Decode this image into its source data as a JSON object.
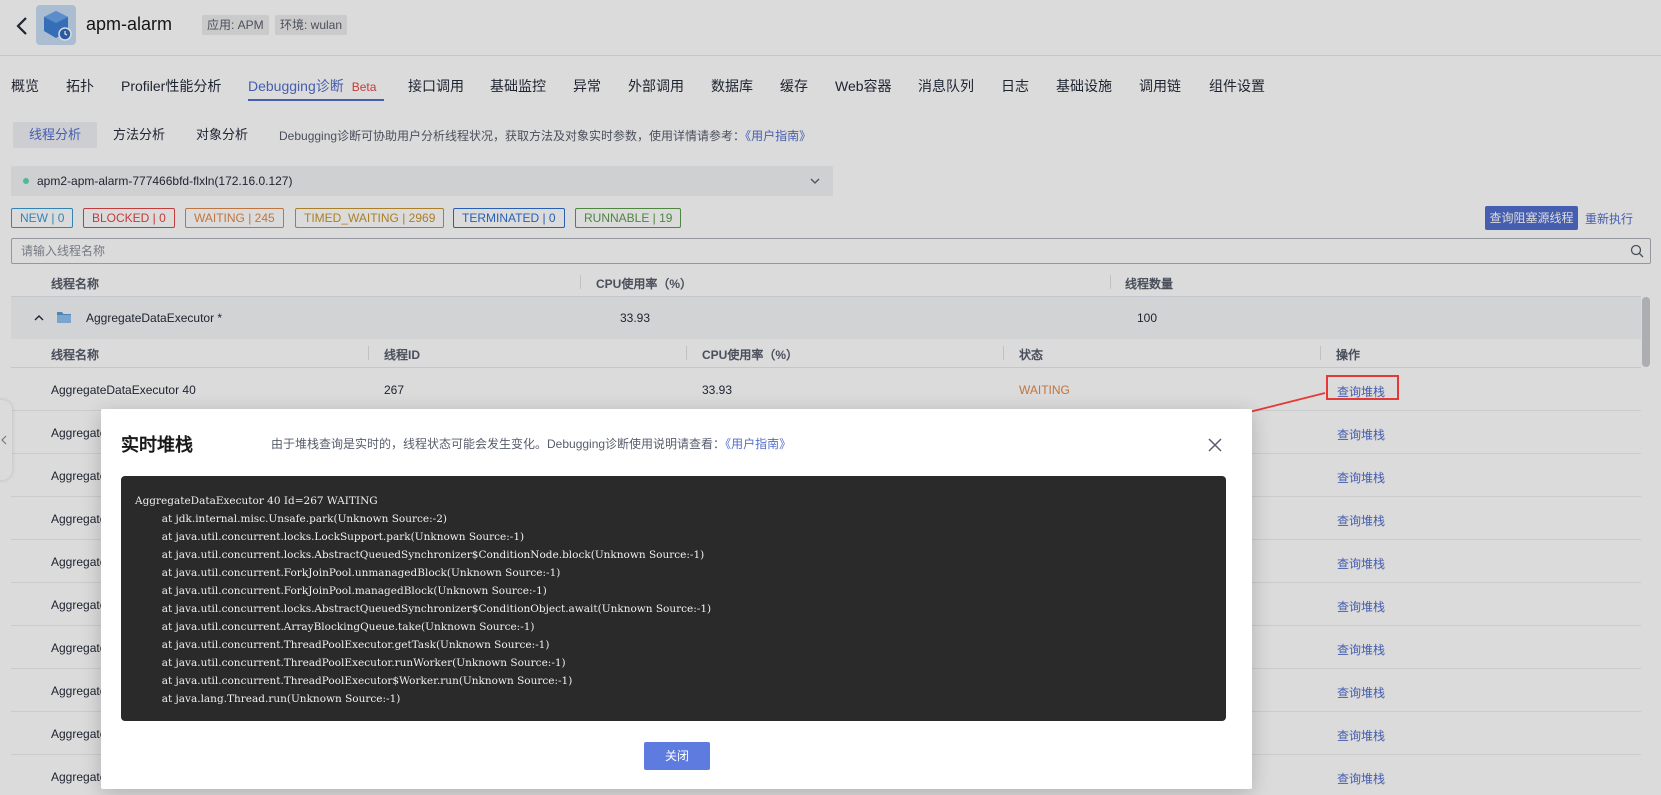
{
  "header": {
    "app_name": "apm-alarm",
    "app_tag": "应用: APM",
    "env_tag": "环境: wulan"
  },
  "nav": {
    "items": [
      "概览",
      "拓扑",
      "Profiler性能分析",
      "Debugging诊断",
      "接口调用",
      "基础监控",
      "异常",
      "外部调用",
      "数据库",
      "缓存",
      "Web容器",
      "消息队列",
      "日志",
      "基础设施",
      "调用链",
      "组件设置"
    ],
    "beta": "Beta"
  },
  "subtabs": {
    "thread": "线程分析",
    "method": "方法分析",
    "object": "对象分析",
    "hint": "Debugging诊断可协助用户分析线程状况，获取方法及对象实时参数，使用详情请参考：",
    "guide": "《用户指南》"
  },
  "instance": {
    "value": "apm2-apm-alarm-777466bfd-flxln(172.16.0.127)"
  },
  "badges": [
    {
      "label": "NEW | 0",
      "color": "#3a9bd4"
    },
    {
      "label": "BLOCKED | 0",
      "color": "#e54545"
    },
    {
      "label": "WAITING | 245",
      "color": "#e0894a"
    },
    {
      "label": "TIMED_WAITING | 2969",
      "color": "#c7942e"
    },
    {
      "label": "TERMINATED | 0",
      "color": "#2f6fd4"
    },
    {
      "label": "RUNNABLE | 19",
      "color": "#5c9b4a"
    }
  ],
  "actions": {
    "query_blocked": "查询阻塞源线程",
    "rerun": "重新执行"
  },
  "search": {
    "placeholder": "请输入线程名称"
  },
  "table": {
    "group_headers": [
      "线程名称",
      "CPU使用率（%）",
      "线程数量"
    ],
    "group": {
      "name": "AggregateDataExecutor *",
      "cpu": "33.93",
      "count": "100"
    },
    "headers": [
      "线程名称",
      "线程ID",
      "CPU使用率（%）",
      "状态",
      "操作"
    ],
    "first_row": {
      "name": "AggregateDataExecutor 40",
      "id": "267",
      "cpu": "33.93",
      "state": "WAITING"
    },
    "row_prefix": "Aggregate",
    "op_label": "查询堆栈"
  },
  "modal": {
    "title": "实时堆栈",
    "desc": "由于堆栈查询是实时的，线程状态可能会发生变化。Debugging诊断使用说明请查看：",
    "guide": "《用户指南》",
    "stack": [
      "AggregateDataExecutor 40 Id=267 WAITING",
      "        at jdk.internal.misc.Unsafe.park(Unknown Source:-2)",
      "        at java.util.concurrent.locks.LockSupport.park(Unknown Source:-1)",
      "        at java.util.concurrent.locks.AbstractQueuedSynchronizer$ConditionNode.block(Unknown Source:-1)",
      "        at java.util.concurrent.ForkJoinPool.unmanagedBlock(Unknown Source:-1)",
      "        at java.util.concurrent.ForkJoinPool.managedBlock(Unknown Source:-1)",
      "        at java.util.concurrent.locks.AbstractQueuedSynchronizer$ConditionObject.await(Unknown Source:-1)",
      "        at java.util.concurrent.ArrayBlockingQueue.take(Unknown Source:-1)",
      "        at java.util.concurrent.ThreadPoolExecutor.getTask(Unknown Source:-1)",
      "        at java.util.concurrent.ThreadPoolExecutor.runWorker(Unknown Source:-1)",
      "        at java.util.concurrent.ThreadPoolExecutor$Worker.run(Unknown Source:-1)",
      "        at java.lang.Thread.run(Unknown Source:-1)"
    ],
    "close_label": "关闭"
  },
  "colors": {
    "accent": "#526ecc",
    "waiting": "#e0894a",
    "annotation": "#e53935"
  }
}
